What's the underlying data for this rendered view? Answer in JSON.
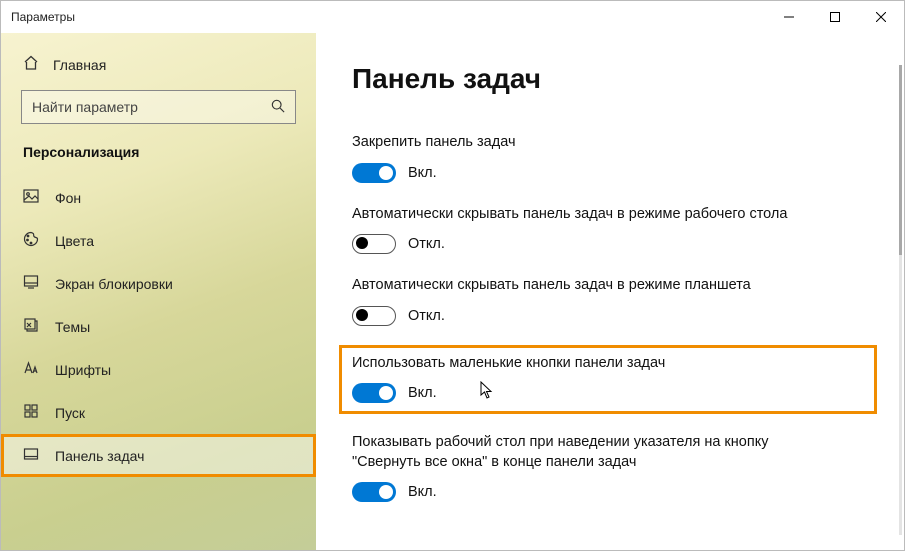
{
  "window": {
    "title": "Параметры"
  },
  "sidebar": {
    "home_label": "Главная",
    "search_placeholder": "Найти параметр",
    "section_title": "Персонализация",
    "items": [
      {
        "name": "background",
        "label": "Фон"
      },
      {
        "name": "colors",
        "label": "Цвета"
      },
      {
        "name": "lockscreen",
        "label": "Экран блокировки"
      },
      {
        "name": "themes",
        "label": "Темы"
      },
      {
        "name": "fonts",
        "label": "Шрифты"
      },
      {
        "name": "start",
        "label": "Пуск"
      },
      {
        "name": "taskbar",
        "label": "Панель задач",
        "selected": true,
        "highlighted": true
      }
    ]
  },
  "page": {
    "title": "Панель задач"
  },
  "settings": [
    {
      "key": "lock_taskbar",
      "label": "Закрепить панель задач",
      "state": "on",
      "state_label": "Вкл."
    },
    {
      "key": "autohide_desktop",
      "label": "Автоматически скрывать панель задач в режиме рабочего стола",
      "state": "off",
      "state_label": "Откл."
    },
    {
      "key": "autohide_tablet",
      "label": "Автоматически скрывать панель задач в режиме планшета",
      "state": "off",
      "state_label": "Откл."
    },
    {
      "key": "small_buttons",
      "label": "Использовать маленькие кнопки панели задач",
      "state": "on",
      "state_label": "Вкл.",
      "highlighted": true,
      "has_cursor": true
    },
    {
      "key": "peek_desktop",
      "label": "Показывать рабочий стол при наведении указателя на кнопку \"Свернуть все окна\" в конце панели задач",
      "state": "on",
      "state_label": "Вкл."
    }
  ],
  "colors": {
    "accent": "#0078d4",
    "highlight_border": "#f08c00"
  }
}
